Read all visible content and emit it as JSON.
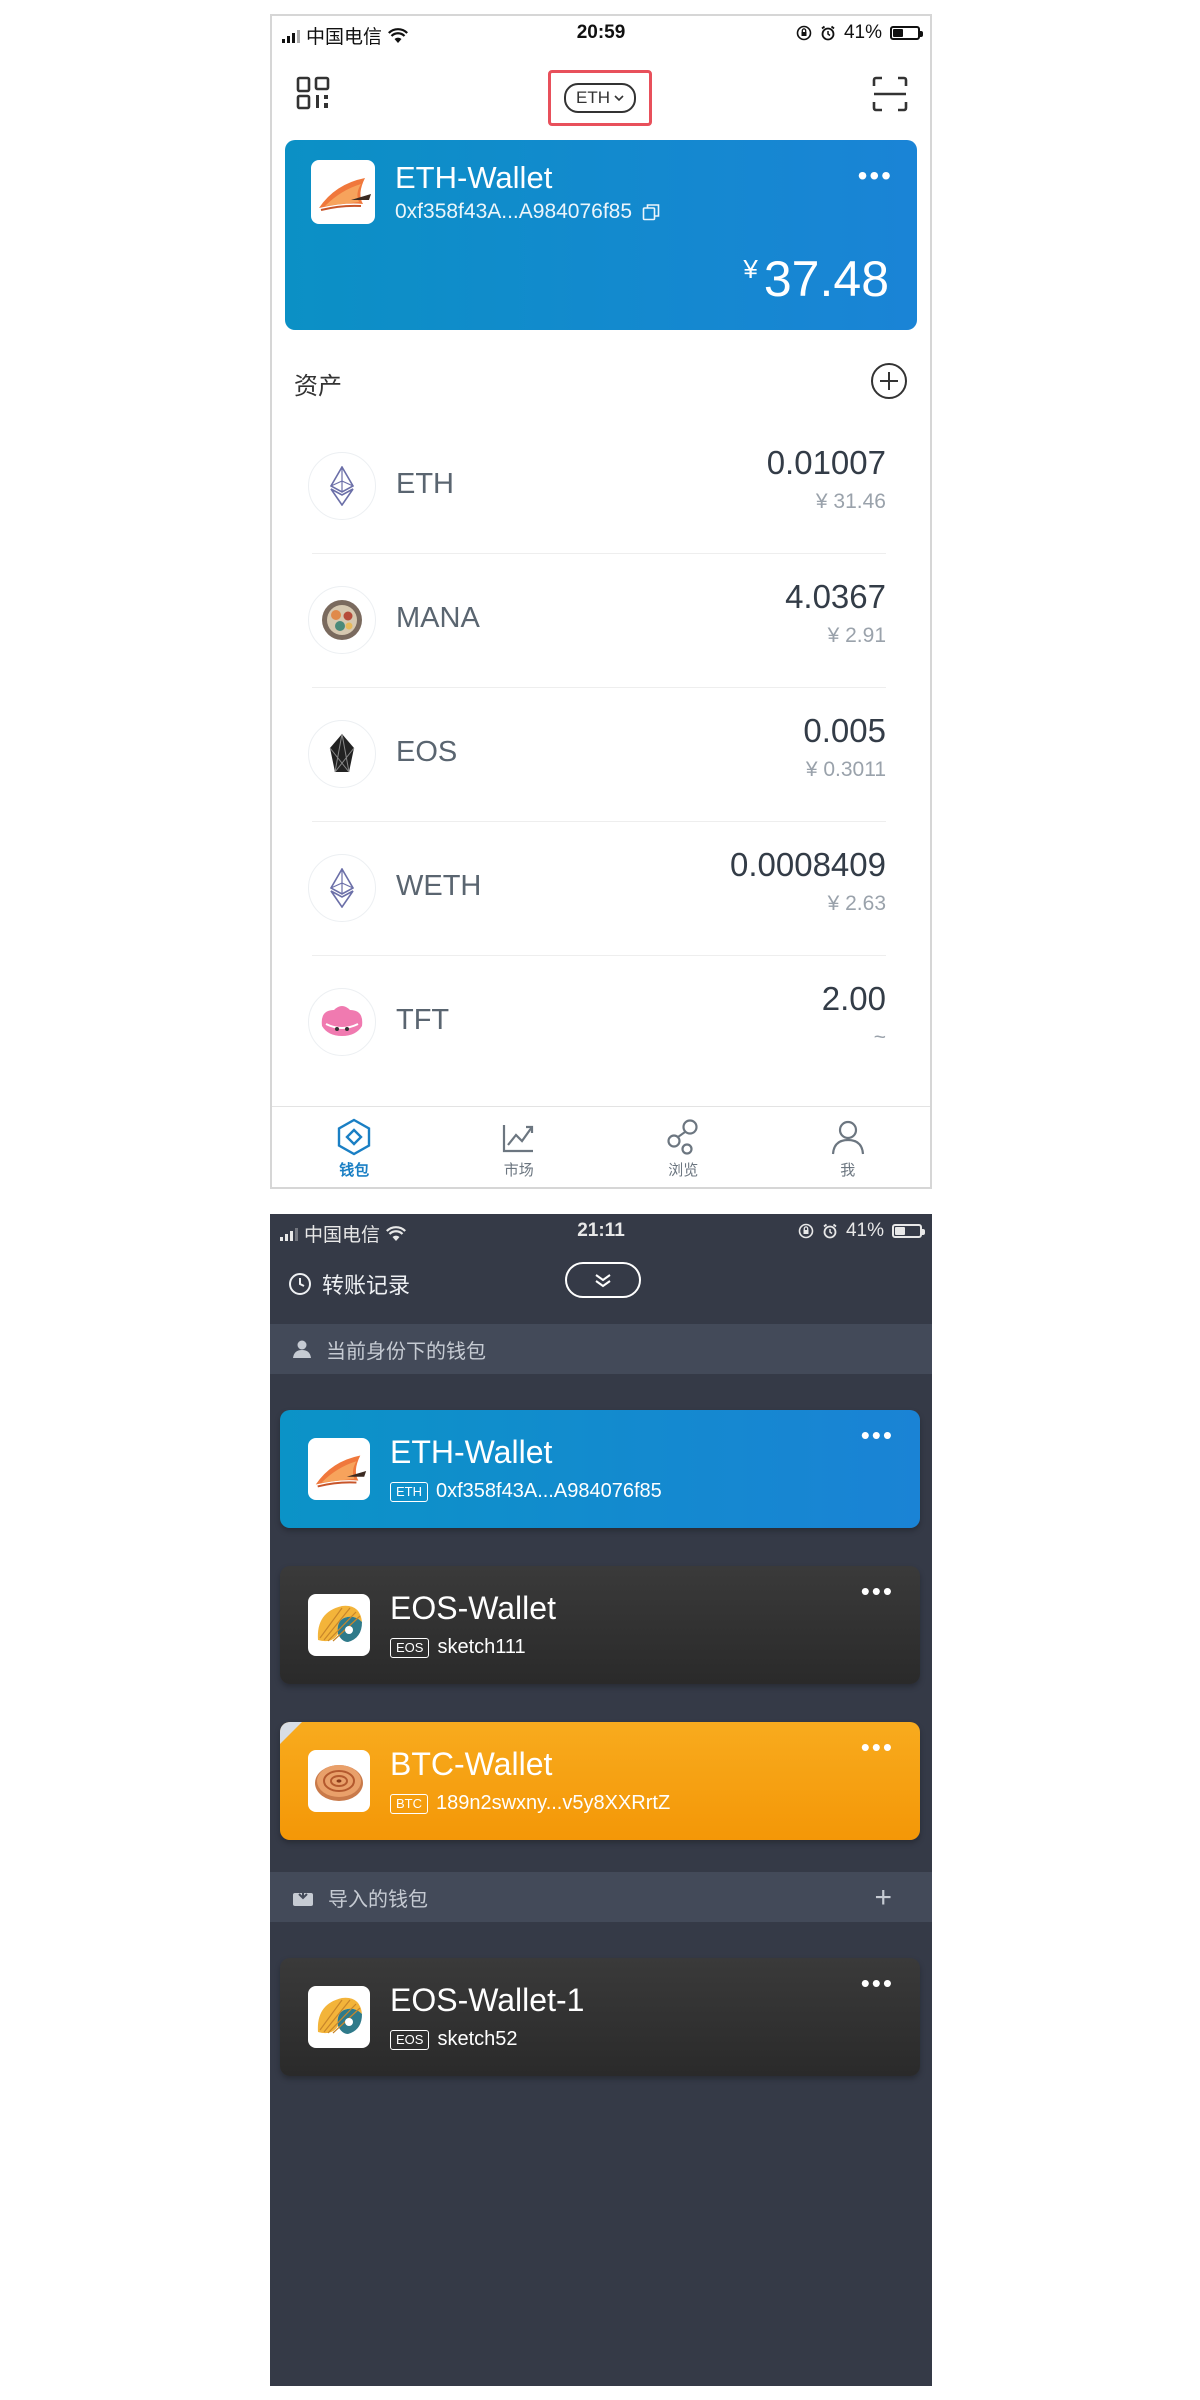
{
  "screen1": {
    "status": {
      "carrier": "中国电信",
      "time": "20:59",
      "battery": "41%",
      "battery_level": 0.41
    },
    "chain_selector": "ETH",
    "wallet": {
      "name": "ETH-Wallet",
      "address": "0xf358f43A...A984076f85",
      "currency_symbol": "¥",
      "balance": "37.48"
    },
    "assets_title": "资产",
    "assets": [
      {
        "symbol": "ETH",
        "balance": "0.01007",
        "value": "¥ 31.46",
        "icon": "eth-icon"
      },
      {
        "symbol": "MANA",
        "balance": "4.0367",
        "value": "¥ 2.91",
        "icon": "mana-icon"
      },
      {
        "symbol": "EOS",
        "balance": "0.005",
        "value": "¥ 0.3011",
        "icon": "eos-icon"
      },
      {
        "symbol": "WETH",
        "balance": "0.0008409",
        "value": "¥ 2.63",
        "icon": "weth-icon"
      },
      {
        "symbol": "TFT",
        "balance": "2.00",
        "value": "~",
        "icon": "tft-icon"
      }
    ],
    "tabs": [
      {
        "label": "钱包",
        "icon": "wallet-icon",
        "active": true
      },
      {
        "label": "市场",
        "icon": "market-icon",
        "active": false
      },
      {
        "label": "浏览",
        "icon": "browse-icon",
        "active": false
      },
      {
        "label": "我",
        "icon": "profile-icon",
        "active": false
      }
    ],
    "colors": {
      "wallet_card": "#1188cc",
      "highlight": "#e8505b",
      "active_tab": "#1a7fc4"
    }
  },
  "screen2": {
    "status": {
      "carrier": "中国电信",
      "time": "21:11",
      "battery": "41%",
      "battery_level": 0.41
    },
    "history_label": "转账记录",
    "identity_section": "当前身份下的钱包",
    "wallets": [
      {
        "name": "ETH-Wallet",
        "chain": "ETH",
        "address": "0xf358f43A...A984076f85",
        "style": "eth"
      },
      {
        "name": "EOS-Wallet",
        "chain": "EOS",
        "address": "sketch111",
        "style": "eos"
      },
      {
        "name": "BTC-Wallet",
        "chain": "BTC",
        "address": "189n2swxny...v5y8XXRrtZ",
        "style": "btc"
      }
    ],
    "imported_section": "导入的钱包",
    "imported_wallets": [
      {
        "name": "EOS-Wallet-1",
        "chain": "EOS",
        "address": "sketch52",
        "style": "eos"
      }
    ],
    "colors": {
      "background": "#353a47",
      "section_bar": "#434a59",
      "btc_card": "#f6a010",
      "eos_card": "#323232"
    }
  }
}
